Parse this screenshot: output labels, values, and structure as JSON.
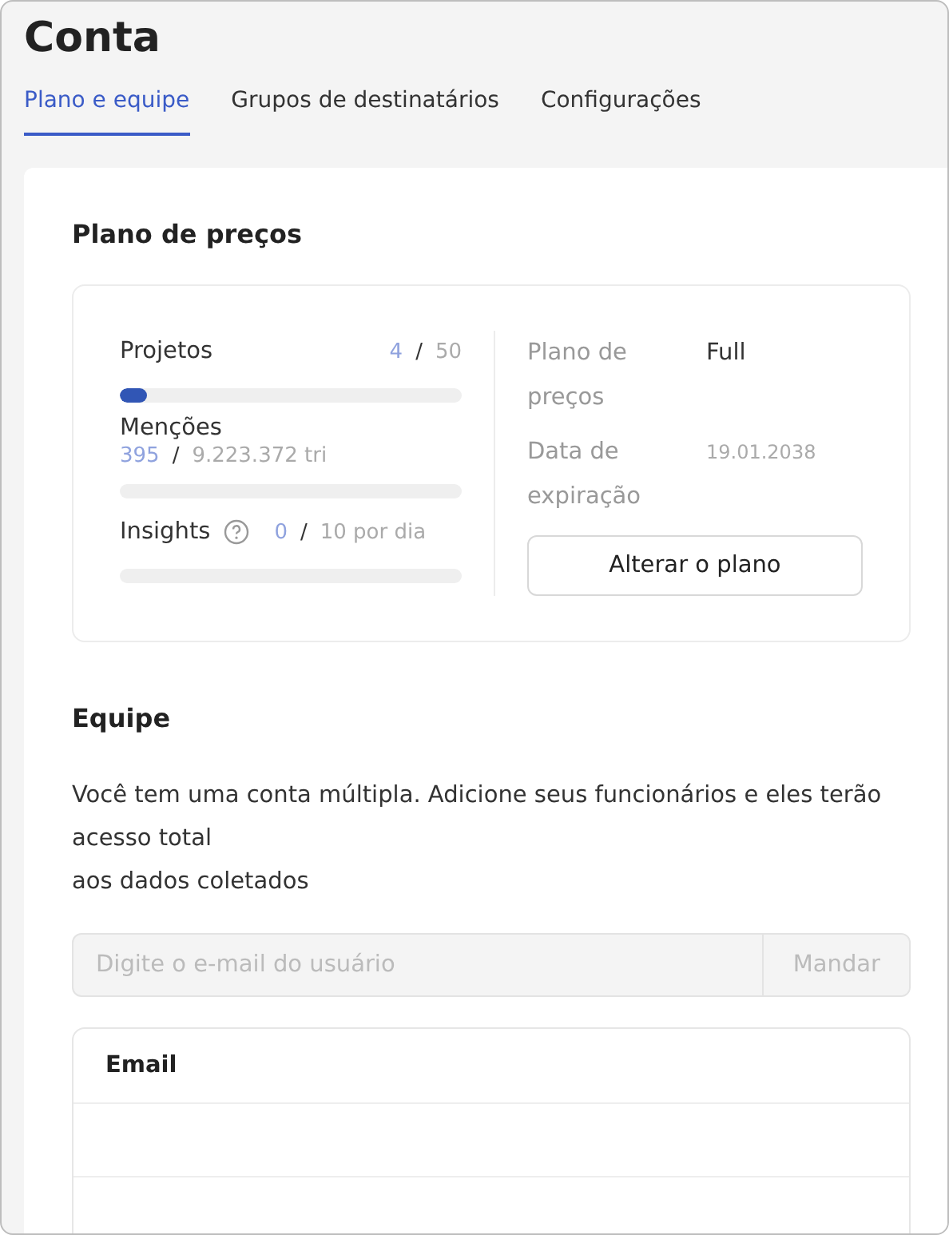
{
  "page_title": "Conta",
  "tabs": [
    {
      "label": "Plano e equipe",
      "selected": true
    },
    {
      "label": "Grupos de destinatários",
      "selected": false
    },
    {
      "label": "Configurações",
      "selected": false
    }
  ],
  "pricing": {
    "title": "Plano de preços",
    "limits": [
      {
        "label": "Projetos",
        "help": false,
        "used": "4",
        "separator": "/",
        "total": "50",
        "level": 0.08,
        "inline": true
      },
      {
        "label": "Menções",
        "help": false,
        "used": "395",
        "separator": "/",
        "total": "9.223.372 tri",
        "inline": false
      },
      {
        "label": "Insights",
        "help": true,
        "used": "0",
        "separator": "/",
        "total": "10 por dia",
        "inline": true
      }
    ],
    "details": [
      {
        "label": "Plano de preços",
        "value": "Full"
      },
      {
        "label": "Data de expiração",
        "value": "19.01.2038"
      }
    ],
    "change_button": "Alterar o plano"
  },
  "team": {
    "title": "Equipe",
    "description": "Você tem uma conta múltipla. Adicione seus funcionários e eles terão acesso total\naos dados coletados",
    "email_field": {
      "placeholder": "Digite o e-mail do usuário",
      "disabled": true
    },
    "send_button": {
      "label": "Mandar",
      "disabled": true
    },
    "table": {
      "columns": [
        "Email"
      ]
    }
  }
}
